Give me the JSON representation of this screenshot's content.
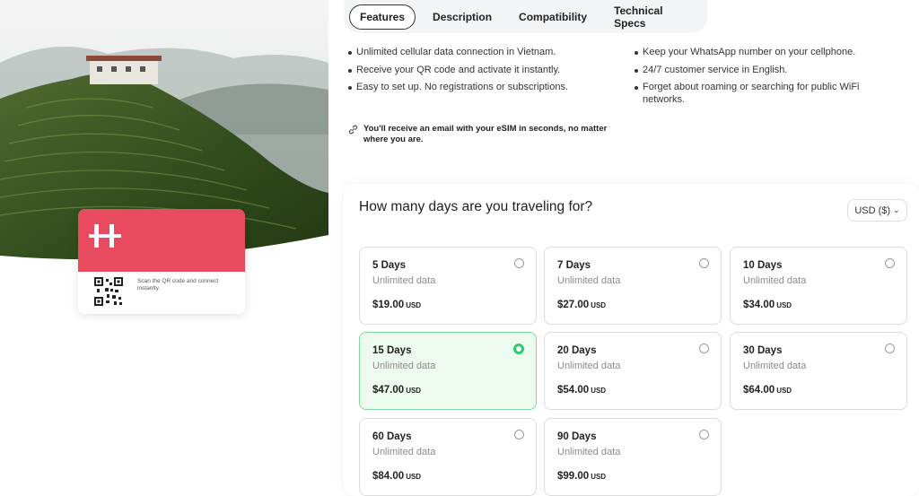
{
  "tabs": [
    {
      "label": "Features",
      "active": true
    },
    {
      "label": "Description",
      "active": false
    },
    {
      "label": "Compatibility",
      "active": false
    },
    {
      "label": "Technical Specs",
      "active": false
    }
  ],
  "features": {
    "left": [
      "Unlimited cellular data connection in Vietnam.",
      "Receive your QR code and activate it instantly.",
      "Easy to set up. No registrations or subscriptions."
    ],
    "right": [
      "Keep your WhatsApp number on your cellphone.",
      "24/7 customer service in English.",
      "Forget about roaming or searching for public WiFi networks."
    ],
    "email_note": "You'll receive an email with your eSIM in seconds, no matter where you are."
  },
  "card": {
    "scan_text": "Scan the QR code and connect instantly."
  },
  "panel": {
    "title": "How many days are you traveling for?",
    "currency": "USD ($)"
  },
  "plans": [
    {
      "name": "5 Days",
      "data": "Unlimited data",
      "price": "$19.00",
      "currency": "USD",
      "selected": false
    },
    {
      "name": "7 Days",
      "data": "Unlimited data",
      "price": "$27.00",
      "currency": "USD",
      "selected": false
    },
    {
      "name": "10 Days",
      "data": "Unlimited data",
      "price": "$34.00",
      "currency": "USD",
      "selected": false
    },
    {
      "name": "15 Days",
      "data": "Unlimited data",
      "price": "$47.00",
      "currency": "USD",
      "selected": true
    },
    {
      "name": "20 Days",
      "data": "Unlimited data",
      "price": "$54.00",
      "currency": "USD",
      "selected": false
    },
    {
      "name": "30 Days",
      "data": "Unlimited data",
      "price": "$64.00",
      "currency": "USD",
      "selected": false
    },
    {
      "name": "60 Days",
      "data": "Unlimited data",
      "price": "$84.00",
      "currency": "USD",
      "selected": false
    },
    {
      "name": "90 Days",
      "data": "Unlimited data",
      "price": "$99.00",
      "currency": "USD",
      "selected": false
    }
  ],
  "colors": {
    "brand": "#e84a5f",
    "selected_bg": "#ecfaef",
    "selected_radio": "#2ecc71"
  }
}
